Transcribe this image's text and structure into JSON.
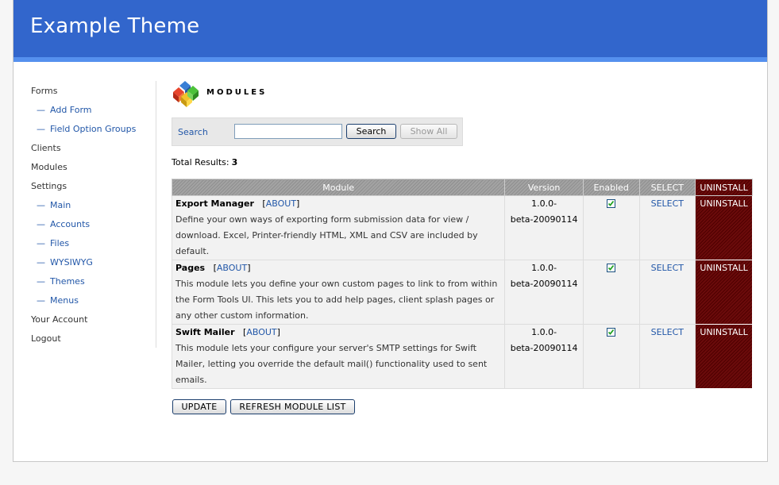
{
  "header": {
    "title": "Example Theme"
  },
  "sidebar": {
    "items": [
      {
        "label": "Forms",
        "sub": false
      },
      {
        "label": "Add Form",
        "sub": true
      },
      {
        "label": "Field Option Groups",
        "sub": true
      },
      {
        "label": "Clients",
        "sub": false
      },
      {
        "label": "Modules",
        "sub": false
      },
      {
        "label": "Settings",
        "sub": false
      },
      {
        "label": "Main",
        "sub": true
      },
      {
        "label": "Accounts",
        "sub": true
      },
      {
        "label": "Files",
        "sub": true
      },
      {
        "label": "WYSIWYG",
        "sub": true
      },
      {
        "label": "Themes",
        "sub": true
      },
      {
        "label": "Menus",
        "sub": true
      },
      {
        "label": "Your Account",
        "sub": false
      },
      {
        "label": "Logout",
        "sub": false
      }
    ],
    "sub_prefix": "—"
  },
  "page": {
    "heading": "MODULES",
    "icon": "modules-cubes-icon"
  },
  "search": {
    "label": "Search",
    "value": "",
    "search_button": "Search",
    "show_all_button": "Show All"
  },
  "results": {
    "label": "Total Results:",
    "count": "3"
  },
  "table": {
    "headers": {
      "module": "Module",
      "version": "Version",
      "enabled": "Enabled",
      "select": "SELECT",
      "uninstall": "UNINSTALL"
    },
    "rows": [
      {
        "name": "Export Manager",
        "about": "ABOUT",
        "description": "Define your own ways of exporting form submission data for view / download. Excel, Printer-friendly HTML, XML and CSV are included by default.",
        "version_line1": "1.0.0-",
        "version_line2": "beta-20090114",
        "enabled": true,
        "select": "SELECT",
        "uninstall": "UNINSTALL"
      },
      {
        "name": "Pages",
        "about": "ABOUT",
        "description": "This module lets you define your own custom pages to link to from within the Form Tools UI. This lets you to add help pages, client splash pages or any other custom information.",
        "version_line1": "1.0.0-",
        "version_line2": "beta-20090114",
        "enabled": true,
        "select": "SELECT",
        "uninstall": "UNINSTALL"
      },
      {
        "name": "Swift Mailer",
        "about": "ABOUT",
        "description": "This module lets your configure your server's SMTP settings for Swift Mailer, letting you override the default mail() functionality used to sent emails.",
        "version_line1": "1.0.0-",
        "version_line2": "beta-20090114",
        "enabled": true,
        "select": "SELECT",
        "uninstall": "UNINSTALL"
      }
    ]
  },
  "actions": {
    "update": "UPDATE",
    "refresh": "REFRESH MODULE LIST"
  },
  "colors": {
    "header_bg": "#3266cc",
    "header_stripe": "#5590ee",
    "link": "#2257a8",
    "uninstall_bg": "#5c0505"
  }
}
